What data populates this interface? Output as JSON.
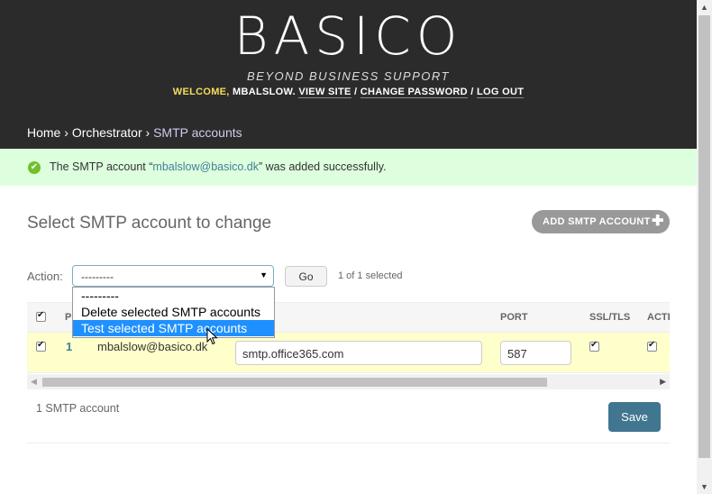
{
  "header": {
    "logo": "BASICO",
    "tagline": "BEYOND BUSINESS SUPPORT",
    "welcome": "WELCOME, ",
    "username": "MBALSLOW",
    "view_site": "VIEW SITE",
    "change_password": "CHANGE PASSWORD",
    "log_out": "LOG OUT",
    "separator": " / "
  },
  "breadcrumbs": {
    "home": "Home",
    "app": "Orchestrator",
    "current": "SMTP accounts",
    "sep": " › "
  },
  "message": {
    "prefix": "The SMTP account “",
    "link": "mbalslow@basico.dk",
    "suffix": "” was added successfully."
  },
  "content": {
    "title": "Select SMTP account to change",
    "add_button": "ADD SMTP ACCOUNT"
  },
  "actions": {
    "label": "Action:",
    "selected_value": "---------",
    "go": "Go",
    "selection_count": "1 of 1 selected",
    "options": [
      "---------",
      "Delete selected SMTP accounts",
      "Test selected SMTP accounts"
    ],
    "highlighted_index": 2
  },
  "table": {
    "columns": {
      "col_p": "P",
      "port": "PORT",
      "ssl_tls": "SSL/TLS",
      "active": "ACTI"
    },
    "rows": [
      {
        "id": "1",
        "email": "mbalslow@basico.dk",
        "host": "smtp.office365.com",
        "port": "587",
        "ssl_tls": true,
        "active": true,
        "selected": true
      }
    ]
  },
  "footer": {
    "paginator": "1 SMTP account",
    "save": "Save"
  },
  "colors": {
    "header_bg": "#2b2b2b",
    "success_bg": "#dddddd",
    "link": "#447e9b",
    "save_bg": "#417690",
    "row_highlight": "#ffffcc",
    "dropdown_highlight": "#1e90ff"
  }
}
